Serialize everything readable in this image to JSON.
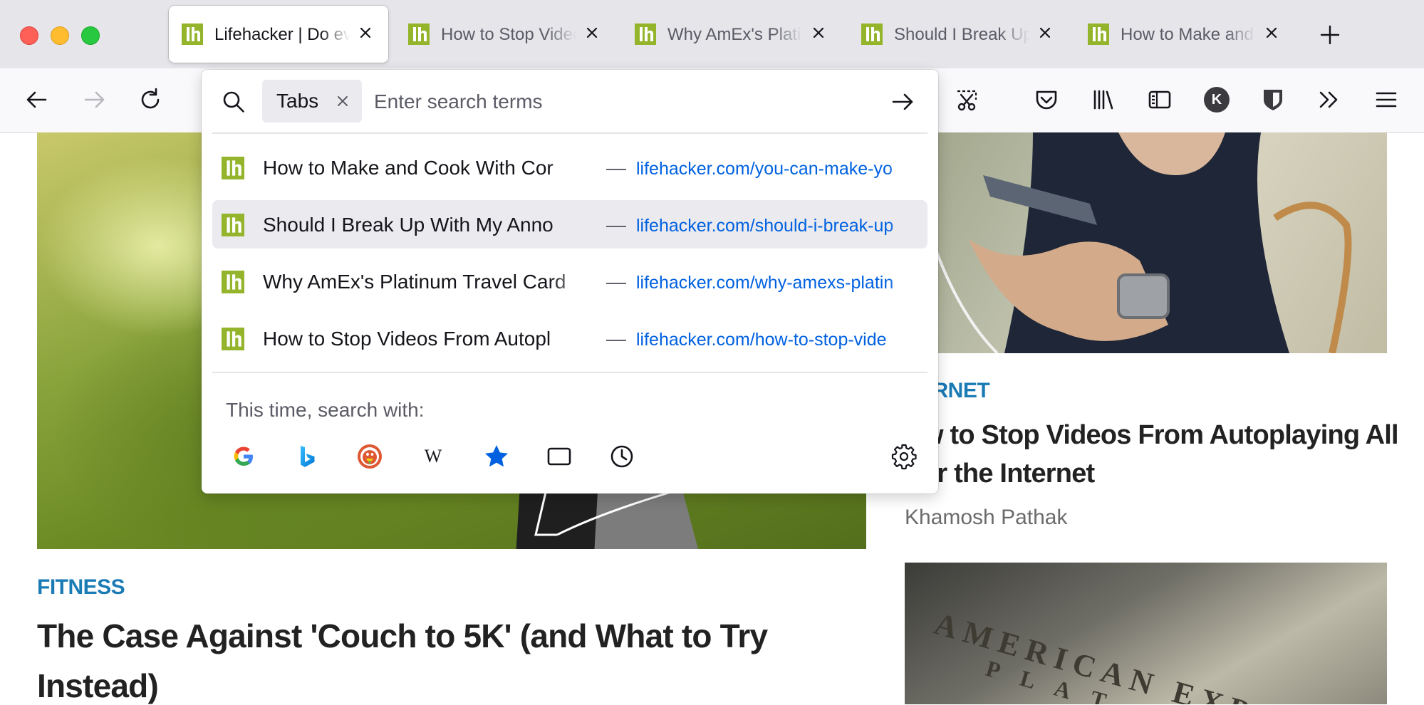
{
  "window": {
    "controls": [
      "close",
      "minimize",
      "zoom"
    ]
  },
  "tabs": [
    {
      "title": "Lifehacker | Do everything better",
      "active": true,
      "icon": "lifehacker-favicon"
    },
    {
      "title": "How to Stop Videos",
      "active": false,
      "icon": "lifehacker-favicon"
    },
    {
      "title": "Why AmEx's Platinum",
      "active": false,
      "icon": "lifehacker-favicon"
    },
    {
      "title": "Should I Break Up",
      "active": false,
      "icon": "lifehacker-favicon"
    },
    {
      "title": "How to Make and Cook",
      "active": false,
      "icon": "lifehacker-favicon"
    }
  ],
  "toolbar": {
    "icons": [
      "back-icon",
      "forward-icon",
      "reload-icon",
      "screenshot-icon",
      "pocket-icon",
      "library-icon",
      "sidebar-icon",
      "account-avatar-icon",
      "bitwarden-icon",
      "overflow-icon",
      "menu-icon"
    ],
    "account_initial": "K"
  },
  "search": {
    "chip_label": "Tabs",
    "placeholder": "Enter search terms",
    "results": [
      {
        "title": "How to Make and Cook With Cor",
        "url": "lifehacker.com/you-can-make-yo"
      },
      {
        "title": "Should I Break Up With My Anno",
        "url": "lifehacker.com/should-i-break-up"
      },
      {
        "title": "Why AmEx's Platinum Travel Card",
        "url": "lifehacker.com/why-amexs-platin"
      },
      {
        "title": "How to Stop Videos From Autopl",
        "url": "lifehacker.com/how-to-stop-vide"
      }
    ],
    "dash": "—",
    "search_with_label": "This time, search with:",
    "engines": [
      "google",
      "bing",
      "duckduckgo",
      "wikipedia",
      "bookmarks",
      "tabs",
      "history"
    ]
  },
  "content": {
    "left_article": {
      "category": "FITNESS",
      "headline_line1": "The Case Against 'Couch to 5K' (and What to Try",
      "headline_line2": "Instead)"
    },
    "right_article": {
      "category": "ERNET",
      "headline_line1": "w to Stop Videos From Autoplaying All",
      "headline_line2": "er the Internet",
      "author": "Khamosh Pathak"
    },
    "card_text_line1": "AMERICAN EXP",
    "card_text_line2": "P L A T"
  },
  "colors": {
    "accent_blue": "#0061e0",
    "category_blue": "#1b7bb5",
    "lifehacker_green": "#94b52b"
  }
}
